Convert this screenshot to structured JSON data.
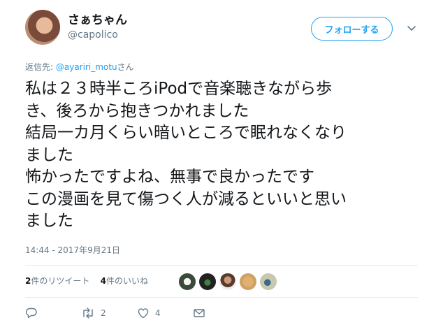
{
  "user": {
    "display_name": "さぁちゃん",
    "handle": "@capolico",
    "avatar_icon": "user-avatar"
  },
  "follow_button": {
    "label": "フォローする"
  },
  "caret_icon": "chevron-down-icon",
  "reply_to": {
    "prefix": "返信先: ",
    "mention": "@ayariri_motu",
    "suffix": "さん"
  },
  "tweet": {
    "lines": [
      "私は２３時半ころiPodで音楽聴きながら歩",
      "き、後ろから抱きつかれました",
      "結局一カ月くらい暗いところで眠れなくなり",
      "ました",
      "怖かったですよね、無事で良かったです",
      "この漫画を見て傷つく人が減るといいと思い",
      "ました"
    ],
    "timestamp": "14:44 - 2017年9月21日"
  },
  "stats": {
    "retweet_count": "2",
    "retweet_label": "件のリツイート",
    "like_count": "4",
    "like_label": "件のいいね",
    "liker_avatars": [
      "avatar-1",
      "avatar-2",
      "avatar-3",
      "avatar-4",
      "avatar-5"
    ]
  },
  "actions": {
    "reply_icon": "reply-icon",
    "retweet_icon": "retweet-icon",
    "retweet_count": "2",
    "like_icon": "heart-icon",
    "like_count": "4",
    "dm_icon": "envelope-icon"
  },
  "colors": {
    "accent": "#1da1f2",
    "muted": "#657786",
    "text": "#14171a",
    "divider": "#e6ecf0"
  }
}
